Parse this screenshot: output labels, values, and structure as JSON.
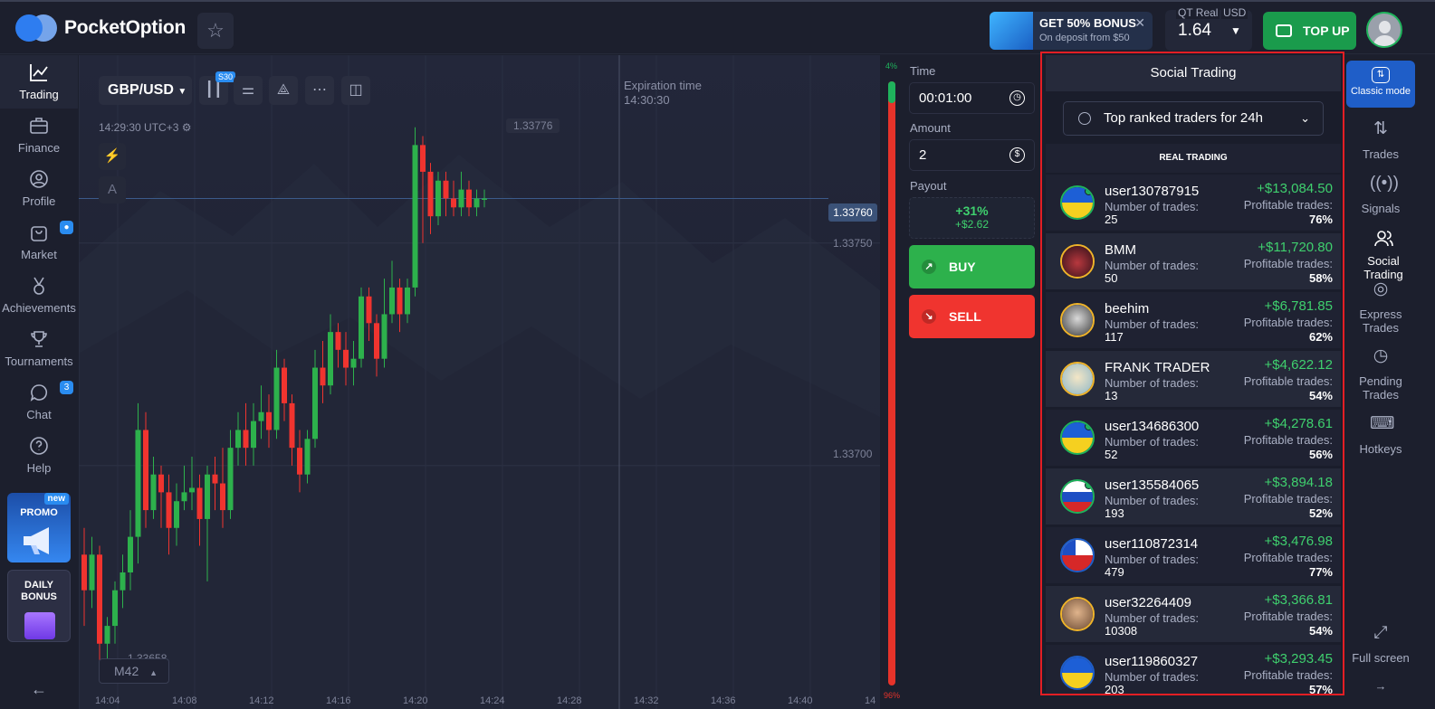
{
  "header": {
    "logo_text": "PocketOption",
    "bonus_title": "GET 50% BONUS",
    "bonus_sub": "On deposit from $50",
    "bonus_close": "✕",
    "account_label": "QT Real",
    "account_currency": "USD",
    "account_balance": "1.64",
    "topup_label": "TOP UP"
  },
  "left_nav": {
    "items": [
      {
        "label": "Trading",
        "icon": "chart-line-icon"
      },
      {
        "label": "Finance",
        "icon": "briefcase-icon"
      },
      {
        "label": "Profile",
        "icon": "user-circle-icon"
      },
      {
        "label": "Market",
        "icon": "shopping-bag-icon"
      },
      {
        "label": "Achievements",
        "icon": "medal-icon"
      },
      {
        "label": "Tournaments",
        "icon": "trophy-icon"
      },
      {
        "label": "Chat",
        "icon": "chat-icon"
      },
      {
        "label": "Help",
        "icon": "help-icon"
      }
    ],
    "chat_badge": "3",
    "promo_label": "PROMO",
    "promo_new": "new",
    "daily_label": "DAILY BONUS"
  },
  "chart": {
    "pair": "GBP/USD",
    "timeframe_badge": "S30",
    "clock": "14:29:30 UTC+3",
    "expiration_label": "Expiration time",
    "expiration_time": "14:30:30",
    "current_price": "1.33760",
    "high_label": "1.33776",
    "price_labels": [
      "1.33750",
      "1.33700"
    ],
    "low_label": "1.33658",
    "x_labels": [
      "14:04",
      "14:08",
      "14:12",
      "14:16",
      "14:20",
      "14:24",
      "14:28",
      "14:32",
      "14:36",
      "14:40",
      "14"
    ],
    "indicator_label": "M42",
    "sentiment_up": "4%",
    "sentiment_down": "96%"
  },
  "chart_data": {
    "type": "candlestick",
    "ylim": [
      1.3365,
      1.3378
    ],
    "candles": [
      {
        "o": 1.3368,
        "c": 1.33672,
        "h": 1.33686,
        "l": 1.33664
      },
      {
        "o": 1.33672,
        "c": 1.3368,
        "h": 1.33684,
        "l": 1.33668
      },
      {
        "o": 1.3368,
        "c": 1.3366,
        "h": 1.33682,
        "l": 1.33654
      },
      {
        "o": 1.3366,
        "c": 1.33664,
        "h": 1.33666,
        "l": 1.33656
      },
      {
        "o": 1.33664,
        "c": 1.33672,
        "h": 1.33674,
        "l": 1.3366
      },
      {
        "o": 1.33672,
        "c": 1.33676,
        "h": 1.3368,
        "l": 1.33668
      },
      {
        "o": 1.33676,
        "c": 1.33684,
        "h": 1.3369,
        "l": 1.33672
      },
      {
        "o": 1.33684,
        "c": 1.33708,
        "h": 1.33714,
        "l": 1.33678
      },
      {
        "o": 1.33708,
        "c": 1.3369,
        "h": 1.33712,
        "l": 1.33686
      },
      {
        "o": 1.3369,
        "c": 1.33698,
        "h": 1.33702,
        "l": 1.33688
      },
      {
        "o": 1.33698,
        "c": 1.33694,
        "h": 1.337,
        "l": 1.33686
      },
      {
        "o": 1.33694,
        "c": 1.33686,
        "h": 1.33698,
        "l": 1.3368
      },
      {
        "o": 1.33686,
        "c": 1.33692,
        "h": 1.33696,
        "l": 1.33682
      },
      {
        "o": 1.33692,
        "c": 1.33694,
        "h": 1.337,
        "l": 1.3369
      },
      {
        "o": 1.33694,
        "c": 1.33695,
        "h": 1.33702,
        "l": 1.3369
      },
      {
        "o": 1.33695,
        "c": 1.33688,
        "h": 1.33698,
        "l": 1.33682
      },
      {
        "o": 1.33688,
        "c": 1.33698,
        "h": 1.337,
        "l": 1.33674
      },
      {
        "o": 1.33698,
        "c": 1.33696,
        "h": 1.33702,
        "l": 1.3369
      },
      {
        "o": 1.33696,
        "c": 1.3369,
        "h": 1.33704,
        "l": 1.33686
      },
      {
        "o": 1.3369,
        "c": 1.33704,
        "h": 1.33708,
        "l": 1.33688
      },
      {
        "o": 1.33704,
        "c": 1.33708,
        "h": 1.33712,
        "l": 1.337
      },
      {
        "o": 1.33708,
        "c": 1.33704,
        "h": 1.33714,
        "l": 1.337
      },
      {
        "o": 1.33704,
        "c": 1.3371,
        "h": 1.33714,
        "l": 1.337
      },
      {
        "o": 1.3371,
        "c": 1.33712,
        "h": 1.33718,
        "l": 1.33706
      },
      {
        "o": 1.33712,
        "c": 1.33708,
        "h": 1.33716,
        "l": 1.33704
      },
      {
        "o": 1.33708,
        "c": 1.33722,
        "h": 1.33726,
        "l": 1.33706
      },
      {
        "o": 1.33722,
        "c": 1.33714,
        "h": 1.33724,
        "l": 1.3371
      },
      {
        "o": 1.33714,
        "c": 1.33704,
        "h": 1.33716,
        "l": 1.337
      },
      {
        "o": 1.33704,
        "c": 1.33698,
        "h": 1.33708,
        "l": 1.33694
      },
      {
        "o": 1.33698,
        "c": 1.33706,
        "h": 1.33708,
        "l": 1.33696
      },
      {
        "o": 1.33706,
        "c": 1.33722,
        "h": 1.33726,
        "l": 1.33704
      },
      {
        "o": 1.33722,
        "c": 1.33718,
        "h": 1.33728,
        "l": 1.33714
      },
      {
        "o": 1.33718,
        "c": 1.3373,
        "h": 1.33734,
        "l": 1.33716
      },
      {
        "o": 1.3373,
        "c": 1.33726,
        "h": 1.33732,
        "l": 1.33722
      },
      {
        "o": 1.33726,
        "c": 1.33722,
        "h": 1.3373,
        "l": 1.33718
      },
      {
        "o": 1.33722,
        "c": 1.33724,
        "h": 1.33728,
        "l": 1.33718
      },
      {
        "o": 1.33724,
        "c": 1.33738,
        "h": 1.3374,
        "l": 1.33722
      },
      {
        "o": 1.33738,
        "c": 1.33732,
        "h": 1.3374,
        "l": 1.33728
      },
      {
        "o": 1.33732,
        "c": 1.33724,
        "h": 1.33734,
        "l": 1.3372
      },
      {
        "o": 1.33724,
        "c": 1.33734,
        "h": 1.33742,
        "l": 1.33722
      },
      {
        "o": 1.33734,
        "c": 1.3374,
        "h": 1.33746,
        "l": 1.33732
      },
      {
        "o": 1.3374,
        "c": 1.33734,
        "h": 1.33742,
        "l": 1.3373
      },
      {
        "o": 1.33734,
        "c": 1.3374,
        "h": 1.33742,
        "l": 1.33732
      },
      {
        "o": 1.3374,
        "c": 1.33772,
        "h": 1.33776,
        "l": 1.33738
      },
      {
        "o": 1.33772,
        "c": 1.33766,
        "h": 1.33774,
        "l": 1.3375
      },
      {
        "o": 1.33766,
        "c": 1.33756,
        "h": 1.33768,
        "l": 1.33752
      },
      {
        "o": 1.33756,
        "c": 1.33764,
        "h": 1.33766,
        "l": 1.33754
      },
      {
        "o": 1.33764,
        "c": 1.3376,
        "h": 1.33766,
        "l": 1.33756
      },
      {
        "o": 1.3376,
        "c": 1.33758,
        "h": 1.33764,
        "l": 1.33756
      },
      {
        "o": 1.33758,
        "c": 1.33762,
        "h": 1.33766,
        "l": 1.33756
      },
      {
        "o": 1.33762,
        "c": 1.33758,
        "h": 1.33764,
        "l": 1.33756
      },
      {
        "o": 1.33758,
        "c": 1.3376,
        "h": 1.33762,
        "l": 1.33756
      },
      {
        "o": 1.3376,
        "c": 1.3376,
        "h": 1.33762,
        "l": 1.33758
      }
    ]
  },
  "trade_panel": {
    "time_label": "Time",
    "time_value": "00:01:00",
    "amount_label": "Amount",
    "amount_value": "2",
    "payout_label": "Payout",
    "payout_pct": "+31%",
    "payout_amt": "+$2.62",
    "buy_label": "BUY",
    "sell_label": "SELL"
  },
  "social": {
    "title": "Social Trading",
    "filter": "Top ranked traders for 24h",
    "section": "REAL TRADING",
    "trades_label": "Number of trades:",
    "pct_label": "Profitable trades:",
    "traders": [
      {
        "name": "user130787915",
        "trades": "25",
        "profit": "+$13,084.50",
        "pct": "76%",
        "flag": "ukraine"
      },
      {
        "name": "BMM",
        "trades": "50",
        "profit": "+$11,720.80",
        "pct": "58%",
        "flag": "avatar"
      },
      {
        "name": "beehim",
        "trades": "117",
        "profit": "+$6,781.85",
        "pct": "62%",
        "flag": "avatar"
      },
      {
        "name": "FRANK TRADER",
        "trades": "13",
        "profit": "+$4,622.12",
        "pct": "54%",
        "flag": "avatar"
      },
      {
        "name": "user134686300",
        "trades": "52",
        "profit": "+$4,278.61",
        "pct": "56%",
        "flag": "ukraine"
      },
      {
        "name": "user135584065",
        "trades": "193",
        "profit": "+$3,894.18",
        "pct": "52%",
        "flag": "russia"
      },
      {
        "name": "user110872314",
        "trades": "479",
        "profit": "+$3,476.98",
        "pct": "77%",
        "flag": "chile"
      },
      {
        "name": "user32264409",
        "trades": "10308",
        "profit": "+$3,366.81",
        "pct": "54%",
        "flag": "avatar"
      },
      {
        "name": "user119860327",
        "trades": "203",
        "profit": "+$3,293.45",
        "pct": "57%",
        "flag": "ukraine"
      }
    ]
  },
  "right_nav": {
    "classic": "Classic mode",
    "items": [
      {
        "label": "Trades",
        "icon": "arrows-icon"
      },
      {
        "label": "Signals",
        "icon": "signal-icon"
      },
      {
        "label": "Social Trading",
        "icon": "users-icon"
      },
      {
        "label": "Express Trades",
        "icon": "target-icon"
      },
      {
        "label": "Pending Trades",
        "icon": "clock-icon"
      },
      {
        "label": "Hotkeys",
        "icon": "keyboard-icon"
      }
    ],
    "fullscreen": "Full screen"
  }
}
